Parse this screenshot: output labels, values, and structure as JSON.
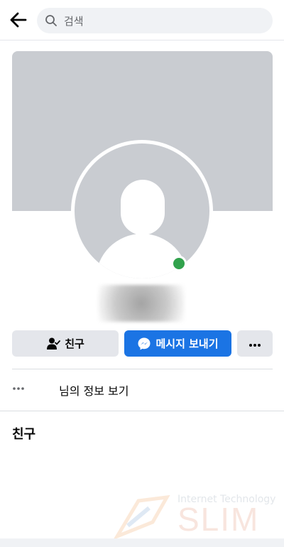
{
  "search": {
    "placeholder": "검색"
  },
  "profile": {
    "online": true
  },
  "actions": {
    "friend_label": "친구",
    "message_label": "메시지 보내기"
  },
  "info": {
    "label": "님의 정보 보기"
  },
  "friends_section": {
    "title": "친구"
  },
  "watermark": {
    "top": "Internet Technology",
    "main": "SLIM"
  },
  "colors": {
    "primary": "#1b74e4",
    "online": "#31a24c",
    "cover": "#c9ccd1",
    "secondary_button": "#e4e6eb"
  }
}
